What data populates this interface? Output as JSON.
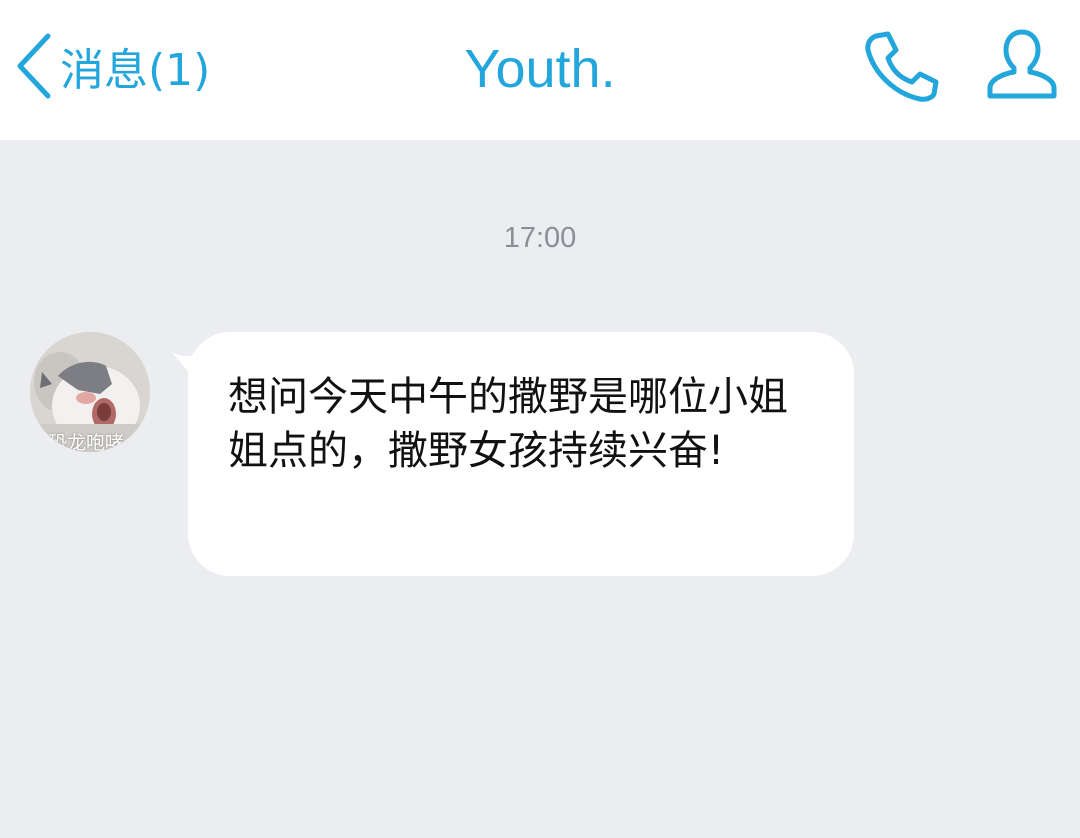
{
  "header": {
    "back_label": "消息(1)",
    "title": "Youth.",
    "back_icon": "chevron-left-icon",
    "call_icon": "phone-icon",
    "profile_icon": "person-icon",
    "accent_color": "#23a6dc"
  },
  "conversation": {
    "timestamp": "17:00",
    "messages": [
      {
        "sender": "received",
        "avatar_caption": "恐龙咆哮",
        "text": "想问今天中午的撒野是哪位小姐姐点的，撒野女孩持续兴奋!"
      }
    ]
  },
  "colors": {
    "background": "#ebedf0",
    "header_background": "#ffffff",
    "bubble_background": "#ffffff",
    "timestamp_color": "#8a8f96"
  }
}
